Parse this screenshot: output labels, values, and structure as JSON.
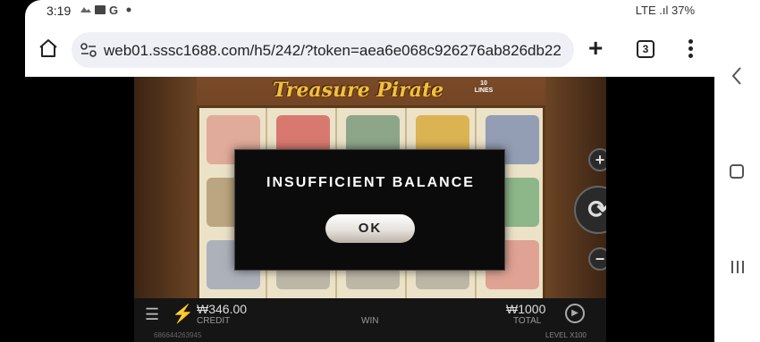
{
  "status_bar": {
    "time": "3:19",
    "notif_icons": "image-icon, google-icon, dot",
    "right_text": "LTE .ıl 37%"
  },
  "browser": {
    "url": "web01.sssc1688.com/h5/242/?token=aea6e068c926276ab826db22",
    "tab_count": "3"
  },
  "game": {
    "title": "Treasure Pirate",
    "lines_badge": "10 LINES",
    "credit_value": "₩346.00",
    "credit_label": "CREDIT",
    "win_label": "WIN",
    "total_value": "₩1000",
    "total_label": "TOTAL",
    "serial": "686644263945",
    "level_label": "LEVEL",
    "level_value": "X100"
  },
  "modal": {
    "message": "INSUFFICIENT BALANCE",
    "ok_label": "OK"
  },
  "colors": {
    "modal_bg": "#0b0b0b",
    "game_title": "#f0c040",
    "url_bar_bg": "#eef0f5"
  }
}
